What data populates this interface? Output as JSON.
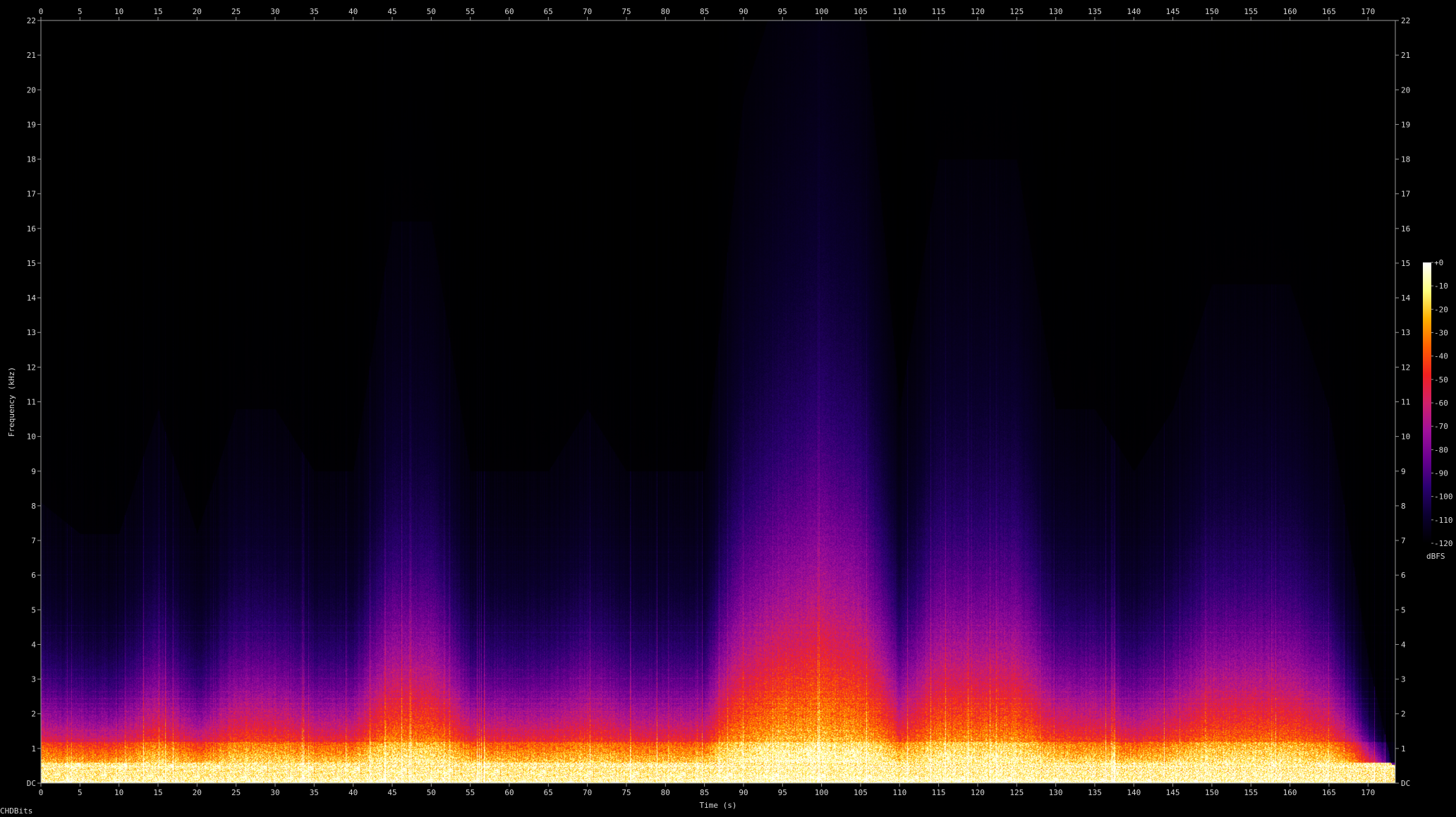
{
  "chart_data": {
    "type": "heatmap",
    "title": "",
    "xlabel": "Time (s)",
    "ylabel": "Frequency (kHz)",
    "xlim": [
      0,
      173.5
    ],
    "ylim": [
      0,
      22
    ],
    "x_ticks": [
      "0",
      "5",
      "10",
      "15",
      "20",
      "25",
      "30",
      "35",
      "40",
      "45",
      "50",
      "55",
      "60",
      "65",
      "70",
      "75",
      "80",
      "85",
      "90",
      "95",
      "100",
      "105",
      "110",
      "115",
      "120",
      "125",
      "130",
      "135",
      "140",
      "145",
      "150",
      "155",
      "160",
      "165",
      "170"
    ],
    "y_ticks": [
      "DC",
      "1",
      "2",
      "3",
      "4",
      "5",
      "6",
      "7",
      "8",
      "9",
      "10",
      "11",
      "12",
      "13",
      "14",
      "15",
      "16",
      "17",
      "18",
      "19",
      "20",
      "21",
      "22"
    ],
    "colorbar": {
      "label": "dBFS",
      "ticks": [
        "+0",
        "-10",
        "-20",
        "-30",
        "-40",
        "-50",
        "-60",
        "-70",
        "-80",
        "-90",
        "-100",
        "-110",
        "-120"
      ],
      "range": [
        -120,
        0
      ],
      "colors": [
        "#000000",
        "#0b0030",
        "#2a0070",
        "#6a0090",
        "#a0109a",
        "#d0206a",
        "#f02020",
        "#ff6000",
        "#ffb000",
        "#ffff80",
        "#ffffff"
      ]
    },
    "energy_profile": {
      "description_x": "time (s)",
      "time": [
        0,
        5,
        10,
        15,
        20,
        25,
        30,
        35,
        40,
        45,
        50,
        55,
        60,
        65,
        70,
        75,
        80,
        85,
        90,
        95,
        100,
        105,
        110,
        115,
        120,
        125,
        130,
        135,
        140,
        145,
        150,
        155,
        160,
        165,
        170,
        173
      ],
      "max_freq_khz": [
        4.5,
        4,
        4,
        6,
        4,
        6,
        6,
        5,
        5,
        9,
        9,
        5,
        5,
        5,
        6,
        5,
        5,
        5,
        11,
        13,
        15,
        13,
        6,
        10,
        10,
        10,
        6,
        6,
        5,
        6,
        8,
        8,
        8,
        6,
        2,
        0.3
      ]
    }
  },
  "watermark": "CHDBits"
}
